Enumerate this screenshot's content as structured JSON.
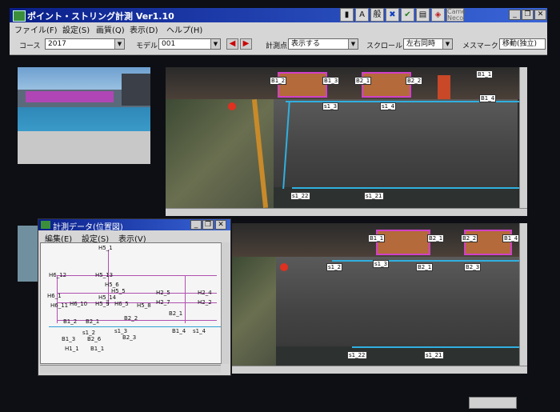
{
  "window": {
    "title": "ポイント・ストリング計測  Ver1.10",
    "min_label": "_",
    "max_label": "❐",
    "close_label": "✕"
  },
  "toolstrip": [
    {
      "name": "marker-tool",
      "glyph": "▮"
    },
    {
      "name": "text-tool",
      "glyph": "A"
    },
    {
      "name": "kanji-tool",
      "glyph": "般"
    },
    {
      "name": "cross-tool",
      "glyph": "✖"
    },
    {
      "name": "check-tool",
      "glyph": "✔"
    },
    {
      "name": "page-tool",
      "glyph": "▤"
    },
    {
      "name": "layer-tool",
      "glyph": "◈"
    },
    {
      "name": "camera-tool",
      "glyph": "Came\nNeco"
    }
  ],
  "menu": [
    "ファイル(F)",
    "設定(S)",
    "画質(Q)",
    "表示(D)",
    "ヘルプ(H)"
  ],
  "toolbar": {
    "course_label": "コース",
    "course_value": "2017",
    "model_label": "モデル",
    "model_value": "001",
    "prev_glyph": "◀",
    "next_glyph": "▶",
    "points_label": "計測点",
    "points_value": "表示する",
    "scroll_label": "スクロール",
    "scroll_value": "左右同時",
    "measure_label": "メスマーク",
    "measure_value": "移動(独立)",
    "dropdown_glyph": "▼"
  },
  "top_points": [
    "B1_2",
    "B1_3",
    "B2_1",
    "B2_2",
    "B1_1",
    "B1_4",
    "s1_3",
    "s1_4",
    "s1_22",
    "s1_21"
  ],
  "bottom_points": [
    "B1_1",
    "B2_1",
    "B2_2",
    "B1_4",
    "s1_2",
    "s1_3",
    "B2_1",
    "B2_3",
    "s1_22",
    "s1_21"
  ],
  "subwindow": {
    "title": "計測データ(位置図)",
    "menu": [
      "編集(E)",
      "設定(S)",
      "表示(V)"
    ],
    "labels": [
      "H5_1",
      "H6_12",
      "H5_13",
      "H5_6",
      "H5_5",
      "H5_14",
      "H6_1",
      "H6_11",
      "H6_10",
      "H5_9",
      "H6_5",
      "H5_8",
      "H2_5",
      "H2_4",
      "H2_7",
      "H2_2",
      "B2_2",
      "B2_1",
      "B1_2",
      "B2_1",
      "s1_2",
      "B1_3",
      "B2_6",
      "s1_3",
      "B2_3",
      "B1_4",
      "s1_4",
      "H1_1",
      "B1_1"
    ]
  }
}
